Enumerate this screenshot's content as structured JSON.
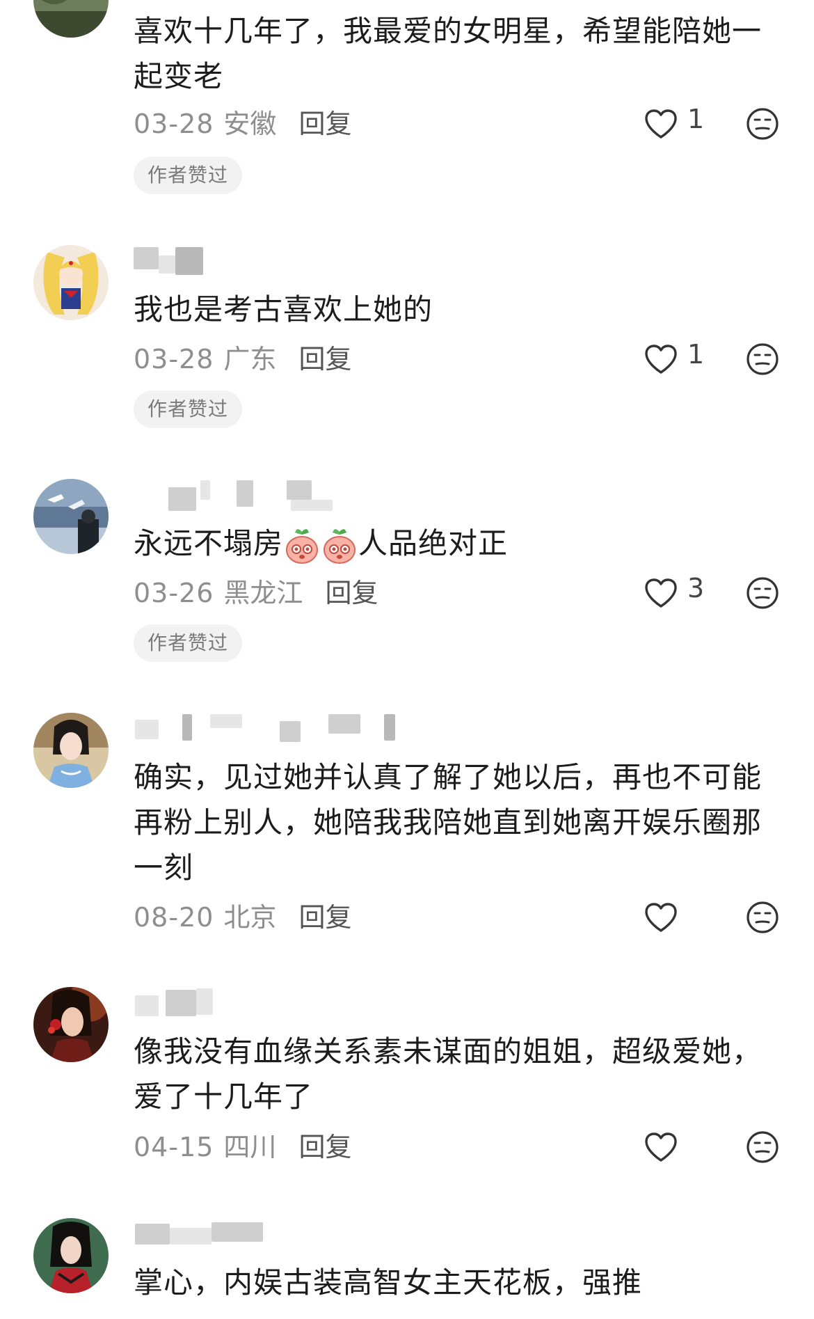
{
  "comments": [
    {
      "text": "喜欢十几年了，我最爱的女明星，希望能陪她一起变老",
      "date": "03-28",
      "location": "安徽",
      "reply_label": "回复",
      "likes": "1",
      "badge": "作者赞过"
    },
    {
      "text": "我也是考古喜欢上她的",
      "date": "03-28",
      "location": "广东",
      "reply_label": "回复",
      "likes": "1",
      "badge": "作者赞过"
    },
    {
      "name_fragment": "～～～～)",
      "text_before": "永远不塌房",
      "text_after": "人品绝对正",
      "date": "03-26",
      "location": "黑龙江",
      "reply_label": "回复",
      "likes": "3",
      "badge": "作者赞过"
    },
    {
      "text": "确实，见过她并认真了解了她以后，再也不可能再粉上别人，她陪我我陪她直到她离开娱乐圈那一刻",
      "date": "08-20",
      "location": "北京",
      "reply_label": "回复",
      "likes": ""
    },
    {
      "text": "像我没有血缘关系素未谋面的姐姐，超级爱她，爱了十几年了",
      "date": "04-15",
      "location": "四川",
      "reply_label": "回复",
      "likes": ""
    },
    {
      "text": "掌心，内娱古装高智女主天花板，强推"
    }
  ],
  "icons": {
    "like": "heart-outline-icon",
    "emoji": "neutral-face-icon",
    "sticker": "pink-peach-sticker"
  },
  "colors": {
    "meta_text": "#8e8e8e",
    "badge_bg": "#f2f2f2",
    "badge_text": "#7a7a7a"
  }
}
